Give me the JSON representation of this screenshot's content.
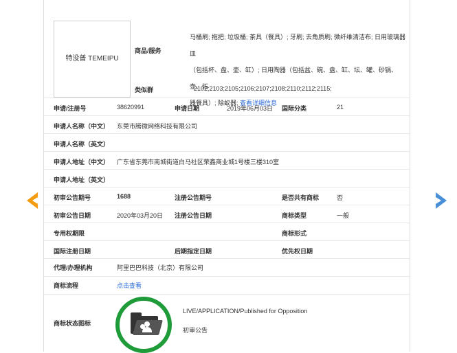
{
  "logo_text": "特没普 TEMEIPU",
  "goods": {
    "label": "商品/服务",
    "line1": "马桶刷; 拖把; 垃圾桶; 茶具（餐具）; 牙刷; 去角质刷; 微纤维清洁布; 日用玻璃器皿",
    "line2": "（包括杯、盘、壶、缸）; 日用陶器（包括盆、碗、盘、缸、坛、罐、砂锅、壶、炻",
    "line3_pre": "器餐具）; 除蚁器;",
    "line3_link": "查看详细信息"
  },
  "similar_group": {
    "label": "类似群",
    "value": "2102;2103;2105;2106;2107;2108;2110;2112;2115;"
  },
  "row_app": {
    "l1": "申请/注册号",
    "v1": "38620991",
    "l2": "申请日期",
    "v2": "2019年06月03日",
    "l3": "国际分类",
    "v3": "21"
  },
  "applicant_cn": {
    "label": "申请人名称（中文）",
    "value": "东莞市腾微网络科技有限公司"
  },
  "applicant_en": {
    "label": "申请人名称（英文）",
    "value": ""
  },
  "address_cn": {
    "label": "申请人地址（中文）",
    "value": "广东省东莞市南城街道白马社区荣鑫商业城1号楼三楼310室"
  },
  "address_en": {
    "label": "申请人地址（英文）",
    "value": ""
  },
  "row_pub1": {
    "l1": "初审公告期号",
    "v1": "1688",
    "l2": "注册公告期号",
    "v2": "",
    "l3": "是否共有商标",
    "v3": "否"
  },
  "row_pub2": {
    "l1": "初审公告日期",
    "v1": "2020年03月20日",
    "l2": "注册公告日期",
    "v2": "",
    "l3": "商标类型",
    "v3": "一般"
  },
  "row_excl": {
    "l1": "专用权期限",
    "v1": "",
    "l3": "商标形式",
    "v3": ""
  },
  "row_intl": {
    "l1": "国际注册日期",
    "l2": "后期指定日期",
    "l3": "优先权日期"
  },
  "agent": {
    "label": "代理/办理机构",
    "value": "阿里巴巴科技（北京）有限公司"
  },
  "flow": {
    "label": "商标流程",
    "link": "点击查看"
  },
  "status": {
    "label": "商标状态图标",
    "en": "LIVE/APPLICATION/Published for Opposition",
    "cn": "初审公告"
  },
  "colors": {
    "arrow_left": "#f39c12",
    "arrow_right": "#4a90d9",
    "status_ring": "#1f9b3a",
    "link": "#2a6ad8"
  }
}
